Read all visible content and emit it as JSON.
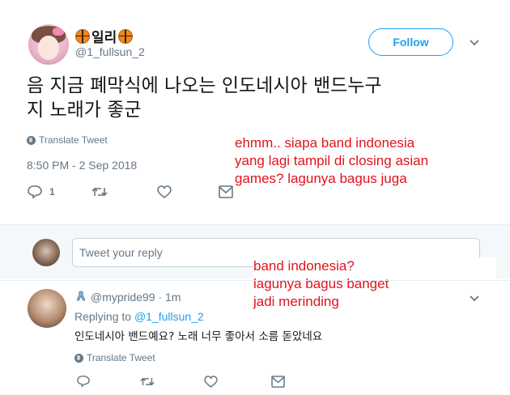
{
  "tweet": {
    "display_name": "일리",
    "display_name_icon": "basketball-emoji",
    "handle": "@1_fullsun_2",
    "follow_label": "Follow",
    "text_line1": "음 지금 폐막식에 나오는 인도네시아 밴드누구",
    "text_line2": "지 노래가 좋군",
    "translate_label": "Translate Tweet",
    "timestamp": "8:50 PM - 2 Sep 2018",
    "reply_count": "1",
    "icons": [
      "reply-icon",
      "retweet-icon",
      "like-icon",
      "message-icon",
      "chevron-down-icon"
    ]
  },
  "reply_box": {
    "placeholder": "Tweet your reply"
  },
  "annotations": {
    "annotation1_line1": "ehmm.. siapa band indonesia",
    "annotation1_line2": "yang lagi tampil di closing asian",
    "annotation1_line3": "games? lagunya bagus juga",
    "annotation2_line1": "band indonesia?",
    "annotation2_line2": "lagunya bagus banget",
    "annotation2_line3": "jadi merinding",
    "color": "#e3121b"
  },
  "reply_tweet": {
    "username": "@mypride99",
    "time": "· 1m",
    "replying_prefix": "Replying to",
    "replying_to": "@1_fullsun_2",
    "text": "인도네시아 밴드예요? 노래 너무 좋아서 소름 돋았네요",
    "translate_label": "Translate Tweet"
  },
  "colors": {
    "accent": "#1da1f2",
    "muted": "#657786",
    "divider": "#e6ecf0"
  }
}
